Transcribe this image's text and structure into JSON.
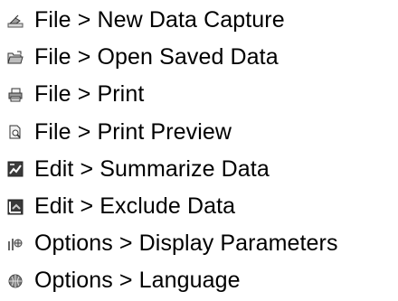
{
  "menu": {
    "items": [
      {
        "label": "File > New Data Capture",
        "icon": "new-data-capture-icon"
      },
      {
        "label": "File > Open Saved Data",
        "icon": "open-folder-icon"
      },
      {
        "label": "File > Print",
        "icon": "printer-icon"
      },
      {
        "label": "File > Print Preview",
        "icon": "print-preview-icon"
      },
      {
        "label": "Edit > Summarize Data",
        "icon": "summarize-data-icon"
      },
      {
        "label": "Edit > Exclude Data",
        "icon": "exclude-data-icon"
      },
      {
        "label": "Options > Display Parameters",
        "icon": "display-parameters-icon"
      },
      {
        "label": "Options > Language",
        "icon": "language-icon"
      }
    ]
  }
}
